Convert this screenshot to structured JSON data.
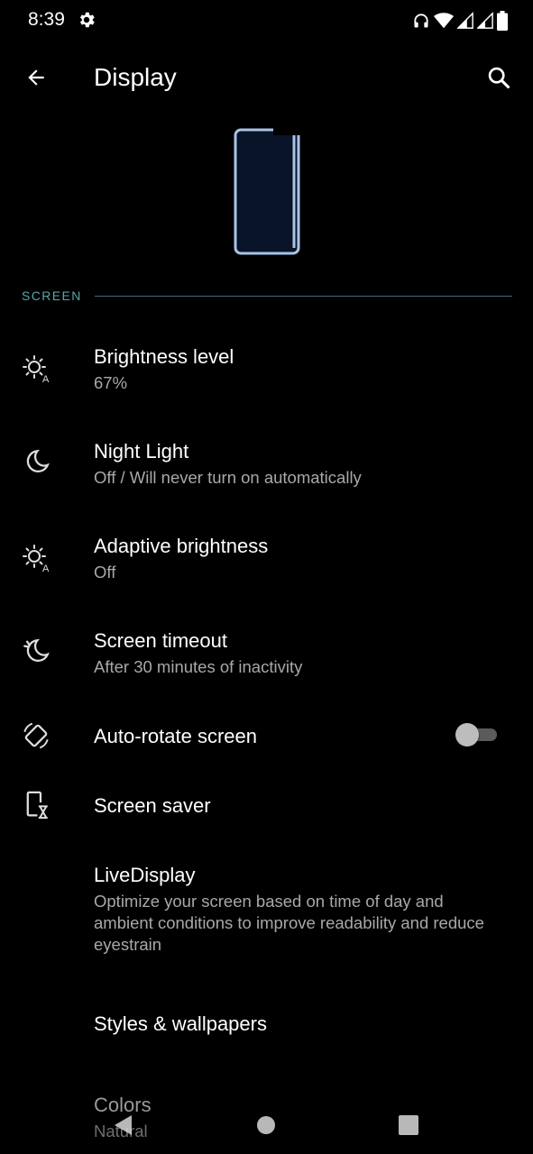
{
  "status_bar": {
    "time": "8:39",
    "icons": [
      "gear-icon",
      "headset-icon",
      "wifi-icon",
      "signal-icon",
      "signal-icon",
      "battery-icon"
    ]
  },
  "app_bar": {
    "title": "Display",
    "back_icon": "arrow-back-icon",
    "search_icon": "search-icon"
  },
  "section": {
    "label": "SCREEN"
  },
  "items": [
    {
      "title": "Brightness level",
      "summary": "67%",
      "icon": "brightness-auto-icon"
    },
    {
      "title": "Night Light",
      "summary": "Off / Will never turn on automatically",
      "icon": "moon-icon"
    },
    {
      "title": "Adaptive brightness",
      "summary": "Off",
      "icon": "brightness-auto-icon"
    },
    {
      "title": "Screen timeout",
      "summary": "After 30 minutes of inactivity",
      "icon": "moon-timer-icon"
    },
    {
      "title": "Auto-rotate screen",
      "icon": "rotate-icon",
      "toggle_on": false
    },
    {
      "title": "Screen saver",
      "icon": "screensaver-icon"
    },
    {
      "title": "LiveDisplay",
      "summary": "Optimize your screen based on time of day and ambient conditions to improve readability and reduce eyestrain"
    },
    {
      "title": "Styles & wallpapers"
    },
    {
      "title": "Colors",
      "summary": "Natural"
    }
  ],
  "nav_bar": {
    "icons": [
      "back-triangle-icon",
      "home-circle-icon",
      "recents-square-icon"
    ]
  },
  "colors": {
    "accent": "#5aa6a6",
    "background": "#000000",
    "illustration_outline": "#a8c4e6"
  }
}
